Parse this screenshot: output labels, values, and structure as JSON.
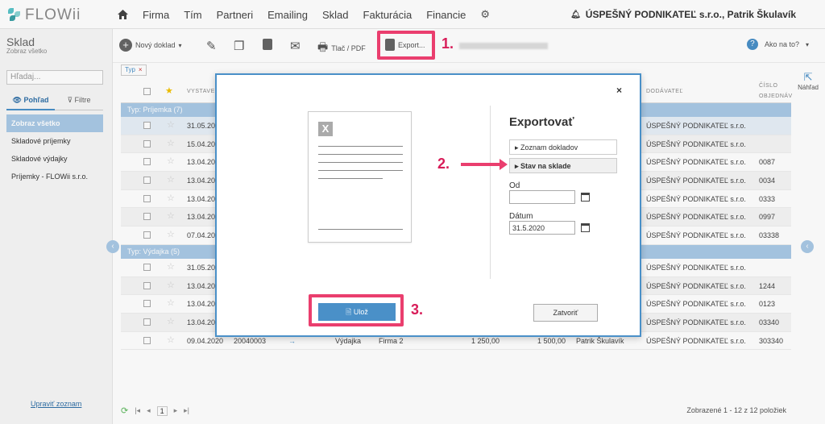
{
  "app": {
    "logo_text": "FLOWii"
  },
  "topnav": {
    "items": [
      "Firma",
      "Tím",
      "Partneri",
      "Emailing",
      "Sklad",
      "Fakturácia",
      "Financie"
    ],
    "company": "ÚSPEŠNÝ PODNIKATEĽ s.r.o., Patrik Škulavík"
  },
  "sidebar": {
    "title": "Sklad",
    "subtitle": "Zobraz všetko",
    "search_placeholder": "Hľadaj...",
    "tab_view": "Pohľad",
    "tab_filter": "Filtre",
    "items": [
      "Zobraz všetko",
      "Skladové príjemky",
      "Skladové výdajky",
      "Príjemky - FLOWii s.r.o."
    ],
    "edit_list": "Upraviť zoznam"
  },
  "toolbar": {
    "new_doc": "Nový doklad",
    "print": "Tlač / PDF",
    "export": "Export...",
    "help": "Ako na to?"
  },
  "filter_chip": {
    "label": "Typ"
  },
  "table": {
    "headers": {
      "created": "VYSTAVE",
      "supplier": "DODÁVATEĽ",
      "order_no_1": "ČÍSLO",
      "order_no_2": "OBJEDNÁV"
    },
    "groups": [
      "Typ: Príjemka (7)",
      "Typ: Výdajka (5)"
    ],
    "rows_group1": [
      {
        "date": "31.05.20",
        "supplier": "ÚSPEŠNÝ PODNIKATEĽ s.r.o.",
        "order": ""
      },
      {
        "date": "15.04.20",
        "supplier": "ÚSPEŠNÝ PODNIKATEĽ s.r.o.",
        "order": ""
      },
      {
        "date": "13.04.20",
        "supplier": "ÚSPEŠNÝ PODNIKATEĽ s.r.o.",
        "order": "0087"
      },
      {
        "date": "13.04.20",
        "supplier": "ÚSPEŠNÝ PODNIKATEĽ s.r.o.",
        "order": "0034"
      },
      {
        "date": "13.04.20",
        "supplier": "ÚSPEŠNÝ PODNIKATEĽ s.r.o.",
        "order": "0333"
      },
      {
        "date": "13.04.20",
        "supplier": "ÚSPEŠNÝ PODNIKATEĽ s.r.o.",
        "order": "0997"
      },
      {
        "date": "07.04.20",
        "supplier": "ÚSPEŠNÝ PODNIKATEĽ s.r.o.",
        "order": "03338"
      }
    ],
    "rows_group2": [
      {
        "date": "31.05.20",
        "supplier": "ÚSPEŠNÝ PODNIKATEĽ s.r.o.",
        "order": ""
      },
      {
        "date": "13.04.20",
        "supplier": "ÚSPEŠNÝ PODNIKATEĽ s.r.o.",
        "order": "1244"
      },
      {
        "date": "13.04.20",
        "supplier": "ÚSPEŠNÝ PODNIKATEĽ s.r.o.",
        "order": "0123"
      },
      {
        "date": "13.04.20",
        "supplier": "ÚSPEŠNÝ PODNIKATEĽ s.r.o.",
        "order": "03340"
      }
    ],
    "last_row": {
      "date": "09.04.2020",
      "number": "20040003",
      "type": "Výdajka",
      "firm": "Firma 2",
      "amount1": "1 250,00",
      "amount2": "1 500,00",
      "person": "Patrik Škulavík",
      "supplier": "ÚSPEŠNÝ PODNIKATEĽ s.r.o.",
      "order": "303340"
    },
    "footer_count": "Zobrazené 1 - 12 z 12 položiek",
    "page": "1"
  },
  "right_panel": {
    "preview": "Náhľad"
  },
  "modal": {
    "title": "Exportovať",
    "options": [
      "Zoznam dokladov",
      "Stav na sklade"
    ],
    "from_label": "Od",
    "from_value": "",
    "date_label": "Dátum",
    "date_value": "31.5.2020",
    "save": "Ulož",
    "close": "Zatvoriť"
  },
  "annotations": {
    "step1": "1.",
    "step2": "2.",
    "step3": "3."
  },
  "colors": {
    "accent": "#4a90c8",
    "highlight": "#ea3e6e",
    "group_row": "#a9c9e6"
  }
}
